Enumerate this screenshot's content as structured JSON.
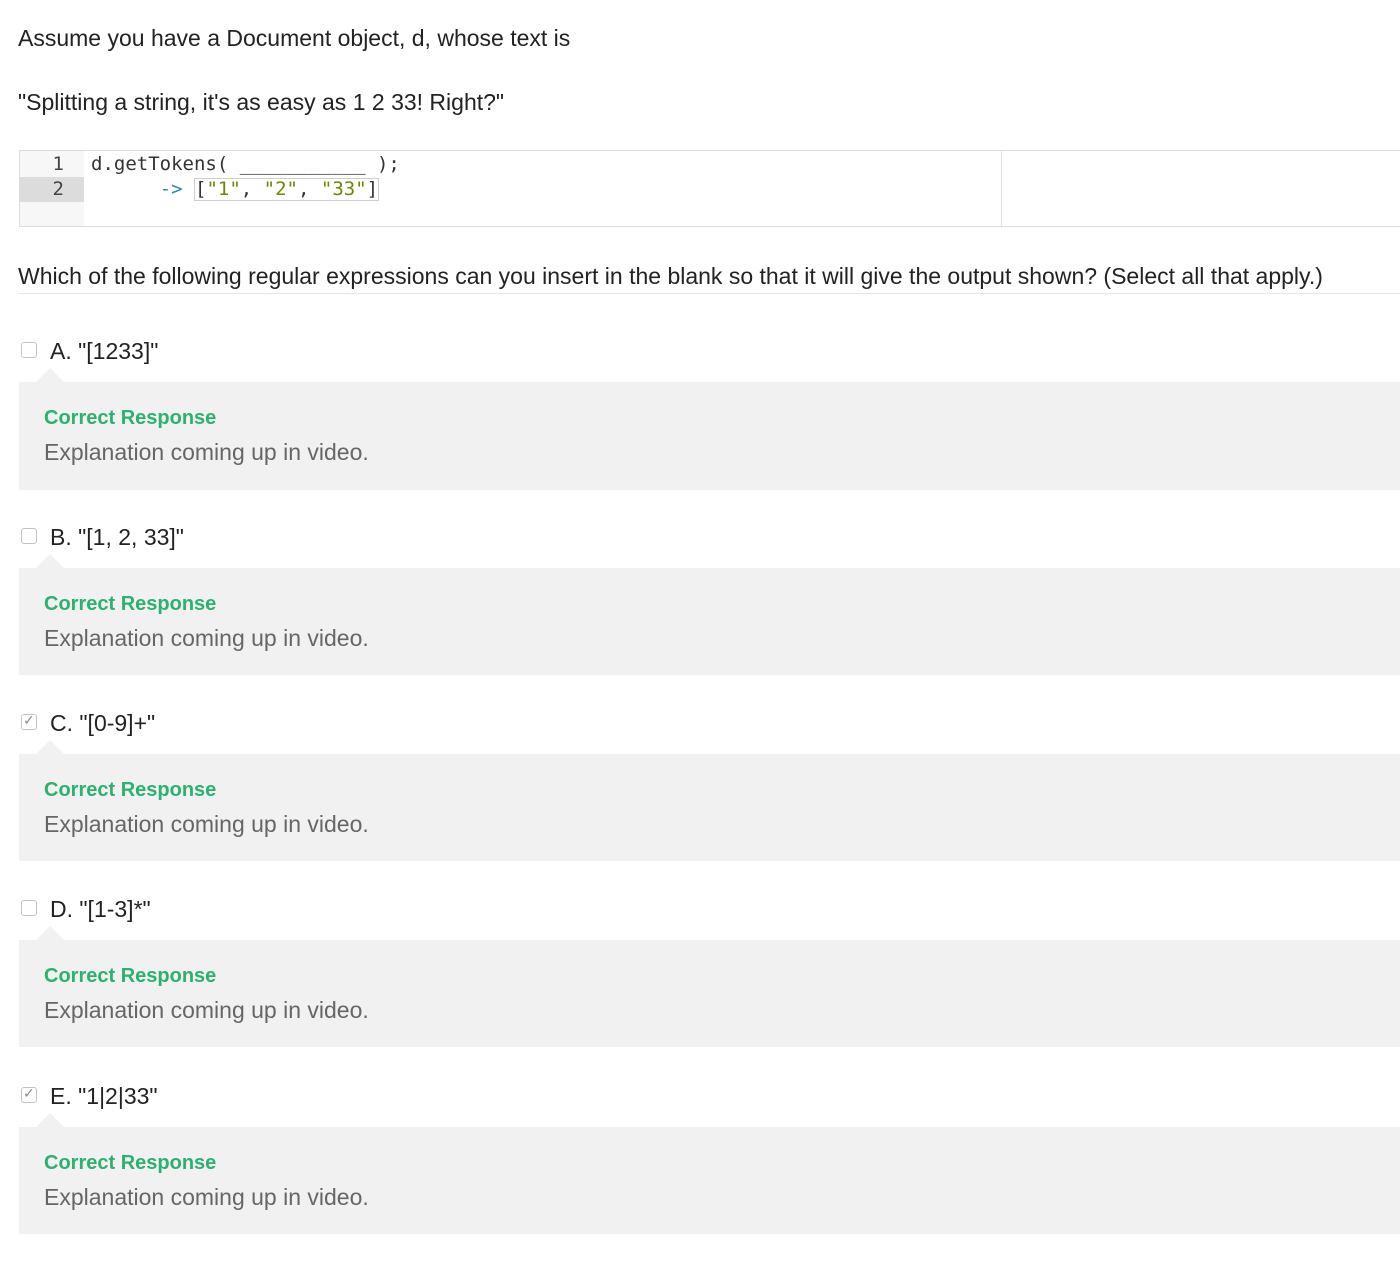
{
  "prompt": {
    "intro": "Assume you have a Document object, d, whose text is",
    "quoted_text": "\"Splitting a string, it's as easy as 1 2 33! Right?\""
  },
  "code": {
    "line_numbers": [
      "1",
      "2"
    ],
    "line1": "d.getTokens( ___________ );",
    "line2_indent": "      ",
    "line2_arrow": "->",
    "line2_open": "[",
    "line2_items": [
      "\"1\"",
      "\"2\"",
      "\"33\""
    ],
    "line2_sep": ", ",
    "line2_close": "]"
  },
  "question": "Which of the following regular expressions can you insert in the blank so that it will give the output shown? (Select all that apply.)",
  "options": [
    {
      "label": "A. \"[1233]\"",
      "checked": false,
      "feedback_title": "Correct Response",
      "feedback_text": "Explanation coming up in video."
    },
    {
      "label": "B. \"[1, 2, 33]\"",
      "checked": false,
      "feedback_title": "Correct Response",
      "feedback_text": "Explanation coming up in video."
    },
    {
      "label": "C. \"[0-9]+\"",
      "checked": true,
      "feedback_title": "Correct Response",
      "feedback_text": "Explanation coming up in video."
    },
    {
      "label": "D. \"[1-3]*\"",
      "checked": false,
      "feedback_title": "Correct Response",
      "feedback_text": "Explanation coming up in video."
    },
    {
      "label": "E. \"1|2|33\"",
      "checked": true,
      "feedback_title": "Correct Response",
      "feedback_text": "Explanation coming up in video."
    }
  ],
  "colors": {
    "correct": "#2cb270",
    "feedback_bg": "#f1f1f1",
    "string_token": "#6a8a00",
    "arrow_token": "#2a8c9c"
  },
  "icons": {
    "checked": "check-icon"
  }
}
